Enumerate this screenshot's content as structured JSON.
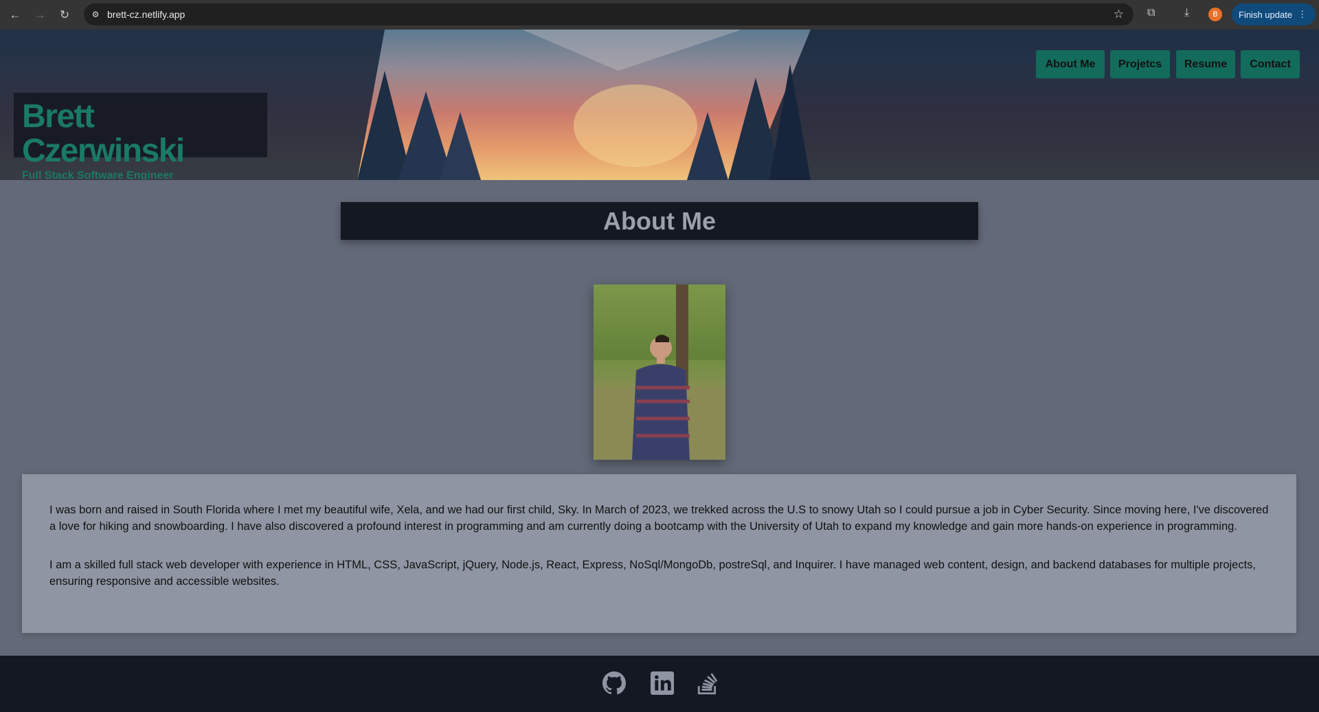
{
  "browser": {
    "url": "brett-cz.netlify.app",
    "profile_initial": "B",
    "finish_update": "Finish update"
  },
  "header": {
    "name": "Brett Czerwinski",
    "subtitle": "Full Stack Software Engineer",
    "nav": [
      {
        "label": "About Me"
      },
      {
        "label": "Projetcs"
      },
      {
        "label": "Resume"
      },
      {
        "label": "Contact"
      }
    ]
  },
  "main": {
    "heading": "About Me",
    "paragraphs": [
      "I was born and raised in South Florida where I met my beautiful wife, Xela, and we had our first child, Sky. In March of 2023, we trekked across the U.S to snowy Utah so I could pursue a job in Cyber Security. Since moving here, I've discovered a love for hiking and snowboarding. I have also discovered a profound interest in programming and am currently doing a bootcamp with the University of Utah to expand my knowledge and gain more hands-on experience in programming.",
      "I am a skilled full stack web developer with experience in HTML, CSS, JavaScript, jQuery, Node.js, React, Express, NoSql/MongoDb, postreSql, and Inquirer. I have managed web content, design, and backend databases for multiple projects, ensuring responsive and accessible websites."
    ]
  },
  "footer": {
    "icons": [
      "github-icon",
      "linkedin-icon",
      "stackoverflow-icon"
    ]
  },
  "colors": {
    "accent": "#136b5c",
    "page_bg": "#636978",
    "dark": "#141822",
    "panel": "#8f95a3"
  }
}
